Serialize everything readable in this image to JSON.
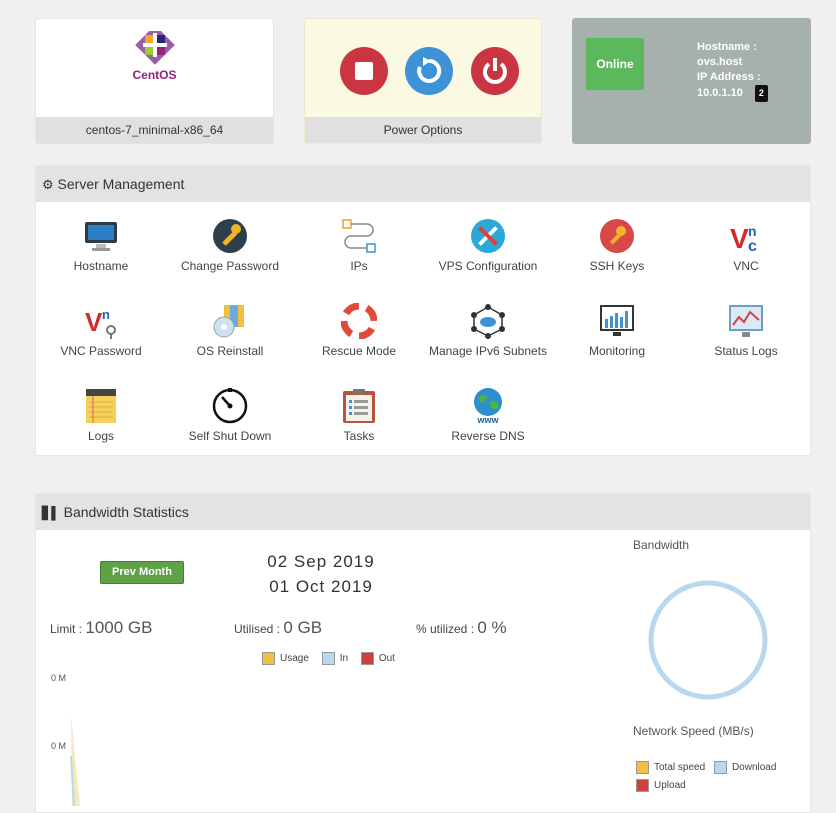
{
  "os_card": {
    "label": "centos-7_minimal-x86_64",
    "logo_text": "CentOS"
  },
  "power_card": {
    "label": "Power Options"
  },
  "status_card": {
    "status": "Online",
    "hostname_label": "Hostname :",
    "hostname": "ovs.host",
    "ip_label": "IP Address :",
    "ip": "10.0.1.10",
    "ip_count": "2",
    "status_color": "#5cb85c"
  },
  "server_management": {
    "title": "Server Management",
    "items": [
      {
        "label": "Hostname",
        "icon": "monitor-icon"
      },
      {
        "label": "Change Password",
        "icon": "key-icon"
      },
      {
        "label": "IPs",
        "icon": "network-icon"
      },
      {
        "label": "VPS Configuration",
        "icon": "tools-icon"
      },
      {
        "label": "SSH Keys",
        "icon": "ssh-key-icon"
      },
      {
        "label": "VNC",
        "icon": "vnc-icon"
      },
      {
        "label": "VNC Password",
        "icon": "vnc-password-icon"
      },
      {
        "label": "OS Reinstall",
        "icon": "os-reinstall-icon"
      },
      {
        "label": "Rescue Mode",
        "icon": "lifebuoy-icon"
      },
      {
        "label": "Manage IPv6 Subnets",
        "icon": "cloud-network-icon"
      },
      {
        "label": "Monitoring",
        "icon": "monitoring-icon"
      },
      {
        "label": "Status Logs",
        "icon": "status-logs-icon"
      },
      {
        "label": "Logs",
        "icon": "notepad-icon"
      },
      {
        "label": "Self Shut Down",
        "icon": "timer-icon"
      },
      {
        "label": "Tasks",
        "icon": "clipboard-icon"
      },
      {
        "label": "Reverse DNS",
        "icon": "globe-www-icon"
      }
    ]
  },
  "bandwidth": {
    "title": "Bandwidth Statistics",
    "prev_month": "Prev Month",
    "date_from": "02 Sep 2019",
    "date_to": "01 Oct 2019",
    "limit_label": "Limit :",
    "limit_value": "1000 GB",
    "utilised_label": "Utilised :",
    "utilised_value": "0 GB",
    "utilized_pct_label": "% utilized :",
    "utilized_pct_value": "0 %",
    "legend": [
      {
        "name": "Usage",
        "color": "#f0c040"
      },
      {
        "name": "In",
        "color": "#b8d8f0"
      },
      {
        "name": "Out",
        "color": "#d04040"
      }
    ],
    "y_ticks": [
      "0 M",
      "0 M"
    ],
    "donut_title": "Bandwidth",
    "speed_title": "Network Speed (MB/s)",
    "speed_legend": [
      {
        "name": "Total speed",
        "color": "#f0c040"
      },
      {
        "name": "Download",
        "color": "#b8d8f0"
      },
      {
        "name": "Upload",
        "color": "#d04040"
      }
    ]
  }
}
